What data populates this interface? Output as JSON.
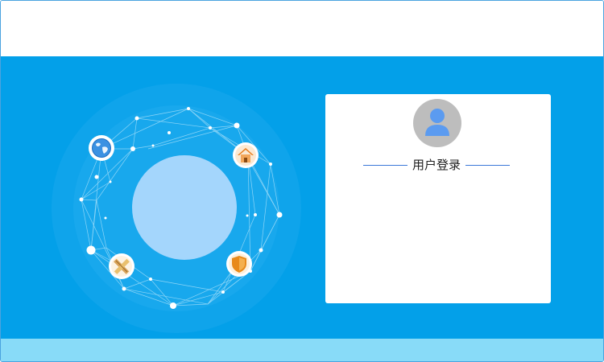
{
  "login": {
    "title": "用户登录",
    "avatar_icon": "user-icon"
  },
  "illustration": {
    "icons": [
      "globe-icon",
      "home-icon",
      "pencil-ruler-icon",
      "shield-icon"
    ]
  },
  "colors": {
    "banner": "#03a0e9",
    "bottom_bar": "#88dbf8",
    "card": "#ffffff",
    "accent_line": "#3c78d8",
    "avatar_bg": "#bdbdbd",
    "avatar_fg": "#5b9bf0"
  }
}
